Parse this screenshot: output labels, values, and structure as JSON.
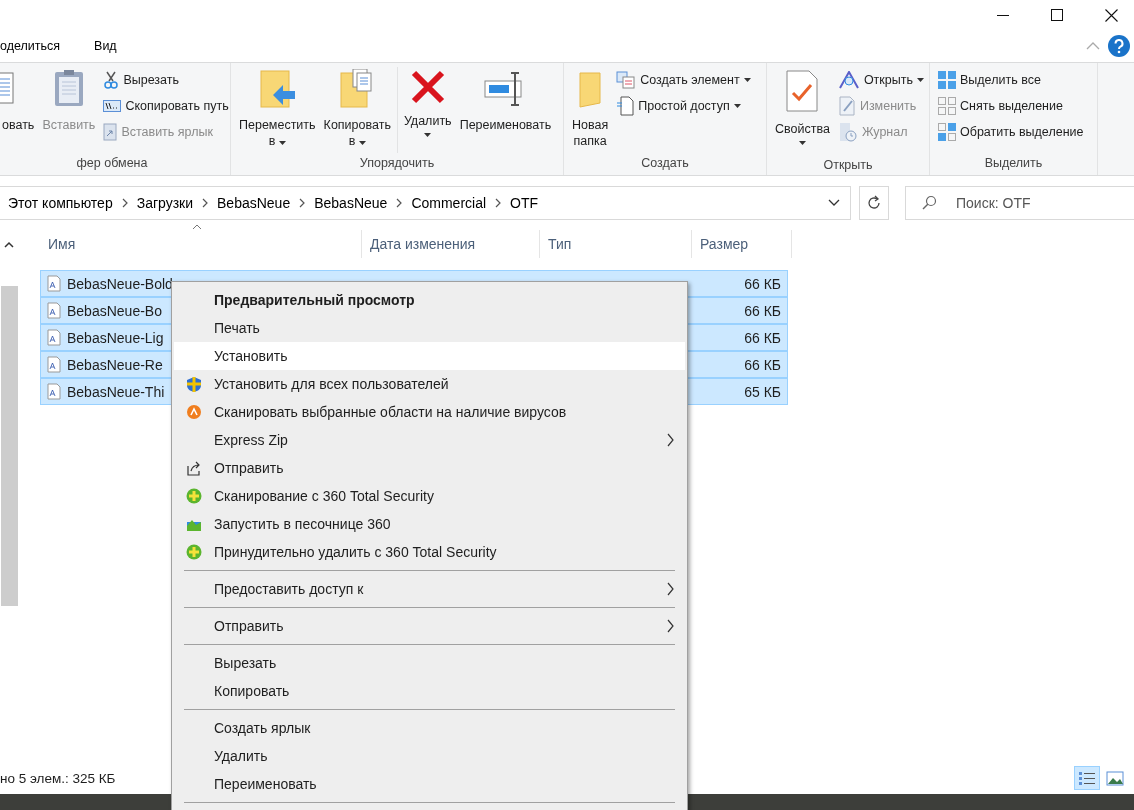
{
  "ribbon_tabs": [
    {
      "label": "оделиться",
      "selected": false
    },
    {
      "label": "Вид",
      "selected": false
    }
  ],
  "ribbon": {
    "groups": [
      {
        "label": "фер обмена",
        "large": [
          {
            "label": "овать",
            "disabled": false
          },
          {
            "label": "Вставить",
            "disabled": true
          }
        ],
        "small": [
          {
            "label": "Вырезать",
            "disabled": false,
            "dropdown": false
          },
          {
            "label": "Скопировать путь",
            "disabled": false,
            "dropdown": false
          },
          {
            "label": "Вставить ярлык",
            "disabled": true,
            "dropdown": false
          }
        ]
      },
      {
        "label": "Упорядочить",
        "large": [
          {
            "label": "Переместить в",
            "disabled": false,
            "dropdown": true
          },
          {
            "label": "Копировать в",
            "disabled": false,
            "dropdown": true
          },
          {
            "label": "Удалить",
            "disabled": false,
            "dropdown": true
          },
          {
            "label": "Переименовать",
            "disabled": false,
            "dropdown": false
          }
        ]
      },
      {
        "label": "Создать",
        "large": [
          {
            "label": "Новая папка",
            "disabled": false,
            "dropdown": false
          }
        ],
        "small": [
          {
            "label": "Создать элемент",
            "disabled": false,
            "dropdown": true
          },
          {
            "label": "Простой доступ",
            "disabled": false,
            "dropdown": true
          }
        ]
      },
      {
        "label": "Открыть",
        "large": [
          {
            "label": "Свойства",
            "disabled": false,
            "dropdown": true
          }
        ],
        "small": [
          {
            "label": "Открыть",
            "disabled": false,
            "dropdown": true
          },
          {
            "label": "Изменить",
            "disabled": true,
            "dropdown": false
          },
          {
            "label": "Журнал",
            "disabled": true,
            "dropdown": false
          }
        ]
      },
      {
        "label": "Выделить",
        "small": [
          {
            "label": "Выделить все",
            "disabled": false,
            "dropdown": false
          },
          {
            "label": "Снять выделение",
            "disabled": false,
            "dropdown": false
          },
          {
            "label": "Обратить выделение",
            "disabled": false,
            "dropdown": false
          }
        ]
      }
    ]
  },
  "address_bar": {
    "path": [
      "Этот компьютер",
      "Загрузки",
      "BebasNeue",
      "BebasNeue",
      "Commercial",
      "OTF"
    ]
  },
  "search": {
    "placeholder": "Поиск: OTF"
  },
  "table": {
    "columns": [
      "Имя",
      "Дата изменения",
      "Тип",
      "Размер"
    ],
    "rows": [
      {
        "name": "BebasNeue-Bold",
        "size": "66 КБ",
        "selected": true
      },
      {
        "name": "BebasNeue-Bo",
        "size": "66 КБ",
        "selected": true
      },
      {
        "name": "BebasNeue-Lig",
        "size": "66 КБ",
        "selected": true
      },
      {
        "name": "BebasNeue-Re",
        "size": "66 КБ",
        "selected": true
      },
      {
        "name": "BebasNeue-Thi",
        "size": "65 КБ",
        "selected": true
      }
    ]
  },
  "status_bar": {
    "text": "но 5 элем.: 325 КБ",
    "views": [
      {
        "selected": true
      },
      {
        "selected": false
      }
    ]
  },
  "context_menu": {
    "sections": [
      [
        {
          "label": "Предварительный просмотр",
          "bold": true,
          "selected": false,
          "submenu": false,
          "kind": "plain"
        },
        {
          "label": "Печать",
          "bold": false,
          "selected": false,
          "submenu": false,
          "kind": "plain"
        },
        {
          "label": "Установить",
          "bold": false,
          "selected": true,
          "submenu": false,
          "kind": "plain"
        },
        {
          "label": "Установить для всех пользователей",
          "bold": false,
          "selected": false,
          "submenu": false,
          "kind": "shield"
        },
        {
          "label": "Сканировать выбранные области на наличие вирусов",
          "bold": false,
          "selected": false,
          "submenu": false,
          "kind": "scan"
        },
        {
          "label": "Express Zip",
          "bold": false,
          "selected": false,
          "submenu": true,
          "kind": "plain"
        },
        {
          "label": "Отправить",
          "bold": false,
          "selected": false,
          "submenu": false,
          "kind": "share"
        },
        {
          "label": "Сканирование с 360 Total Security",
          "bold": false,
          "selected": false,
          "submenu": false,
          "kind": "plus"
        },
        {
          "label": "Запустить в песочнице 360",
          "bold": false,
          "selected": false,
          "submenu": false,
          "kind": "sandbox"
        },
        {
          "label": "Принудительно удалить с  360 Total Security",
          "bold": false,
          "selected": false,
          "submenu": false,
          "kind": "plus"
        }
      ],
      [
        {
          "label": "Предоставить доступ к",
          "bold": false,
          "selected": false,
          "submenu": true,
          "kind": "plain"
        }
      ],
      [
        {
          "label": "Отправить",
          "bold": false,
          "selected": false,
          "submenu": true,
          "kind": "plain"
        }
      ],
      [
        {
          "label": "Вырезать",
          "bold": false,
          "selected": false,
          "submenu": false,
          "kind": "plain"
        },
        {
          "label": "Копировать",
          "bold": false,
          "selected": false,
          "submenu": false,
          "kind": "plain"
        }
      ],
      [
        {
          "label": "Создать ярлык",
          "bold": false,
          "selected": false,
          "submenu": false,
          "kind": "plain"
        },
        {
          "label": "Удалить",
          "bold": false,
          "selected": false,
          "submenu": false,
          "kind": "plain"
        },
        {
          "label": "Переименовать",
          "bold": false,
          "selected": false,
          "submenu": false,
          "kind": "plain"
        }
      ]
    ]
  }
}
